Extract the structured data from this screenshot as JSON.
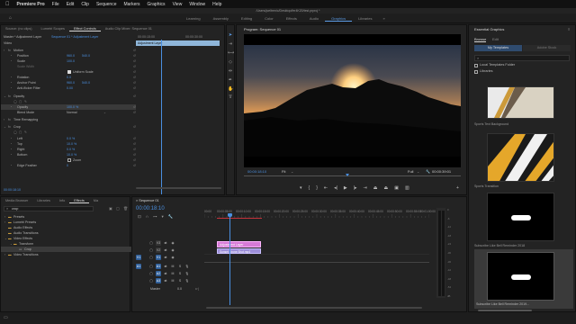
{
  "menubar": {
    "apple": "",
    "app": "Premiere Pro",
    "items": [
      "File",
      "Edit",
      "Clip",
      "Sequence",
      "Markers",
      "Graphics",
      "View",
      "Window",
      "Help"
    ]
  },
  "window_title": "/Users/joeltrenic/Desktop/fer4K20/test.prproj *",
  "workspaces": {
    "items": [
      "Learning",
      "Assembly",
      "Editing",
      "Color",
      "Effects",
      "Audio",
      "Graphics",
      "Libraries"
    ],
    "active": "Graphics",
    "more": "»"
  },
  "effect_controls": {
    "tabs": [
      "Source: (no clips)",
      "Lumetri Scopes",
      "Effect Controls",
      "Audio Clip Mixer: Sequence 01"
    ],
    "active_tab": "Effect Controls",
    "master_label": "Master * Adjustment Layer",
    "sequence_label": "Sequence 01 * Adjustment Layer",
    "timecode_start": "00:00:15:00",
    "timecode_end": "00:00:30:00",
    "clip_name": "Adjustment Layer",
    "section_video": "Video",
    "rows": [
      {
        "label": "Motion"
      },
      {
        "label": "Position",
        "value": "960.0",
        "value2": "540.0"
      },
      {
        "label": "Scale",
        "value": "100.0"
      },
      {
        "label": "Scale Width",
        "value": ""
      },
      {
        "label": "Uniform Scale"
      },
      {
        "label": "Rotation",
        "value": "0.0"
      },
      {
        "label": "Anchor Point",
        "value": "960.0",
        "value2": "540.0"
      },
      {
        "label": "Anti-flicker Filter",
        "value": "0.00"
      },
      {
        "label": "Opacity"
      },
      {
        "label": "Opacity",
        "value": "100.0 %"
      },
      {
        "label": "Blend Mode",
        "value": "Normal"
      },
      {
        "label": "Time Remapping"
      },
      {
        "label": "Crop"
      },
      {
        "label": "Left",
        "value": "0.0 %"
      },
      {
        "label": "Top",
        "value": "10.0 %"
      },
      {
        "label": "Right",
        "value": "0.0 %"
      },
      {
        "label": "Bottom",
        "value": "10.0 %"
      },
      {
        "label": "Zoom"
      },
      {
        "label": "Edge Feather",
        "value": "0"
      }
    ],
    "footer_timecode": "00:00:18:10"
  },
  "program_monitor": {
    "title": "Program: Sequence 01",
    "timecode": "00:00:18:10",
    "fit": "Fit",
    "quality": "Full",
    "duration": "00:00:39:01"
  },
  "media_browser": {
    "tabs": [
      "Media Browser",
      "Libraries",
      "Info",
      "Effects",
      "Ma"
    ],
    "active_tab": "Effects",
    "search": "crop",
    "tree": [
      "Presets",
      "Lumetri Presets",
      "Audio Effects",
      "Audio Transitions",
      "Video Effects",
      "Transform",
      "Crop",
      "Video Transitions"
    ]
  },
  "timeline": {
    "tab": "Sequence 01",
    "timecode": "00:00:18:10",
    "ruler": [
      "00:00",
      "00:00:05:00",
      "00:00:10:00",
      "00:00:15:00",
      "00:00:20:00",
      "00:00:25:00",
      "00:00:30:00",
      "00:00:35:00",
      "00:00:40:00",
      "00:00:45:00",
      "00:00:50:00",
      "00:00:55:00",
      "00:01:00:00"
    ],
    "tracks_v": [
      "V3",
      "V2",
      "V1"
    ],
    "tracks_a": [
      "A1",
      "A2",
      "A3"
    ],
    "master": "Master",
    "master_value": "0.0",
    "clips": [
      {
        "name": "Adjustment Layer",
        "color": "#d67ad6"
      },
      {
        "name": "Sunset Drone Shot.mp4",
        "color": "#9d8fd9"
      }
    ],
    "meter_marks": [
      "0",
      "-6",
      "-12",
      "-18",
      "-24",
      "-30",
      "-36",
      "-42",
      "-48",
      "-54",
      "dB"
    ]
  },
  "essential_graphics": {
    "title": "Essential Graphics",
    "tabs": [
      "Browse",
      "Edit"
    ],
    "active_tab": "Browse",
    "scope": "My Templates",
    "scope2": "Adobe Stock",
    "search_placeholder": "",
    "folders": [
      "Local Templates Folder",
      "Libraries"
    ],
    "templates": [
      {
        "name": "Sports Text Background"
      },
      {
        "name": "Sports Transition"
      },
      {
        "name": "Subscribe Like Bell Reminder 2018"
      },
      {
        "name": "Subscribe Like Bell Reminder 2019..."
      }
    ]
  },
  "colors": {
    "accent": "#4a8fe0",
    "clip_adjustment": "#d67ad6",
    "clip_video": "#9d8fd9",
    "playhead": "#4a8fe0",
    "work_area": "#c4323a"
  }
}
